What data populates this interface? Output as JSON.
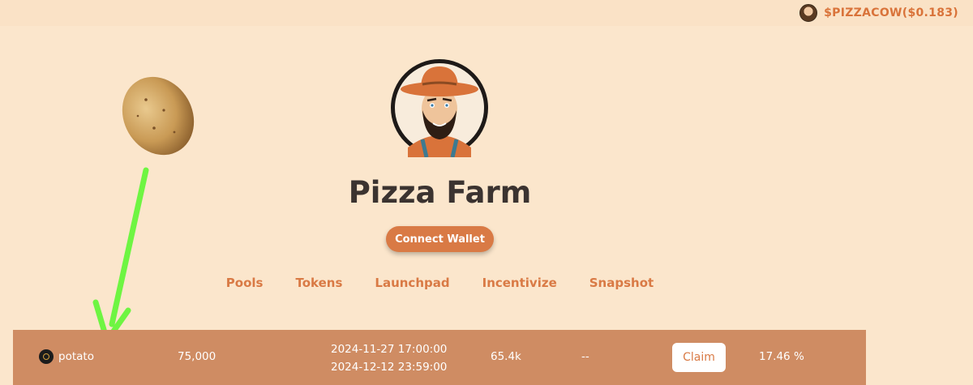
{
  "header": {
    "token_label": "$PIZZACOW($0.183)"
  },
  "hero": {
    "title": "Pizza Farm",
    "connect_label": "Connect Wallet"
  },
  "nav": {
    "items": [
      "Pools",
      "Tokens",
      "Launchpad",
      "Incentivize",
      "Snapshot"
    ]
  },
  "pool_row": {
    "token": "potato",
    "amount": "75,000",
    "start": "2024-11-27 17:00:00",
    "end": "2024-12-12 23:59:00",
    "tvl": "65.4k",
    "dash": "--",
    "claim_label": "Claim",
    "apr": "17.46 %"
  },
  "colors": {
    "background": "#fbe6cc",
    "accent": "#d97a45",
    "row": "#cf8c63",
    "title": "#3b3330",
    "arrow": "#6ef542"
  },
  "icons": [
    "pizzacow-token-icon",
    "potato-image",
    "green-arrow-icon",
    "farmer-logo",
    "potato-token-icon"
  ]
}
